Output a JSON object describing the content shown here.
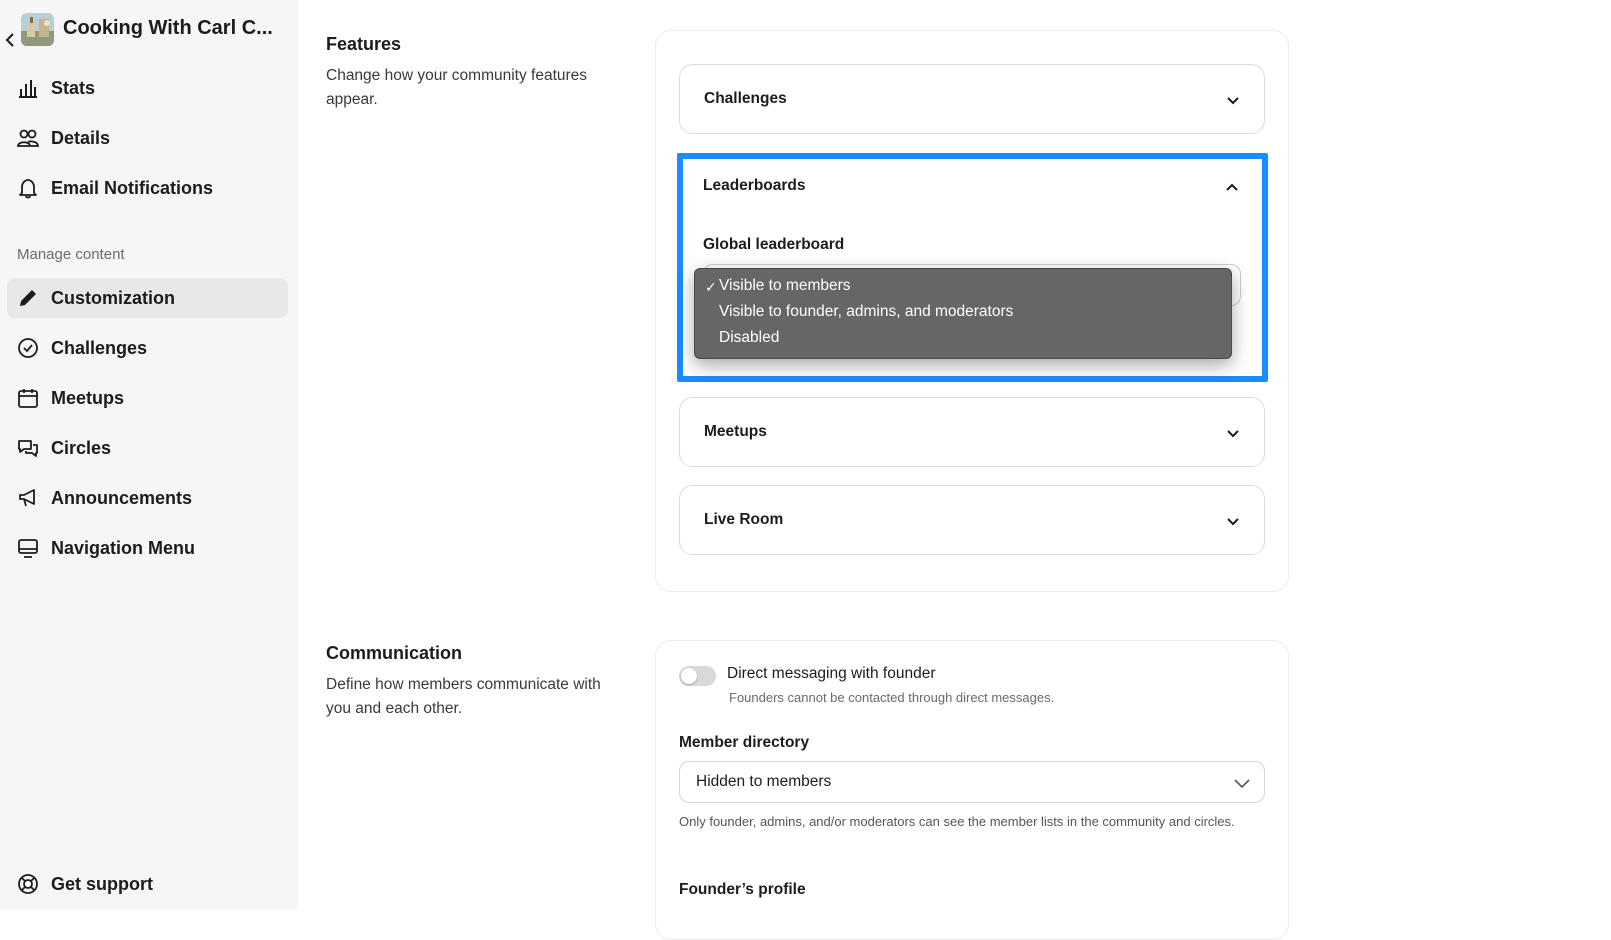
{
  "sidebar": {
    "community_name": "Cooking With Carl C...",
    "items": [
      {
        "label": "Stats",
        "icon": "bar-chart-icon"
      },
      {
        "label": "Details",
        "icon": "users-icon"
      },
      {
        "label": "Email Notifications",
        "icon": "bell-icon"
      }
    ],
    "section_label": "Manage content",
    "content_items": [
      {
        "label": "Customization",
        "icon": "pencil-icon",
        "active": true
      },
      {
        "label": "Challenges",
        "icon": "check-circle-icon"
      },
      {
        "label": "Meetups",
        "icon": "calendar-icon"
      },
      {
        "label": "Circles",
        "icon": "chat-bubbles-icon"
      },
      {
        "label": "Announcements",
        "icon": "megaphone-icon"
      },
      {
        "label": "Navigation Menu",
        "icon": "monitor-icon"
      }
    ],
    "support_label": "Get support"
  },
  "features": {
    "title": "Features",
    "description": "Change how your community features appear.",
    "accordions": {
      "challenges": "Challenges",
      "leaderboards": "Leaderboards",
      "meetups": "Meetups",
      "live_room": "Live Room"
    },
    "global_leaderboard_label": "Global leaderboard",
    "dropdown_options": [
      "Visible to members",
      "Visible to founder, admins, and moderators",
      "Disabled"
    ],
    "dropdown_check": "✓"
  },
  "communication": {
    "title": "Communication",
    "description": "Define how members communicate with you and each other.",
    "dm_label": "Direct messaging with founder",
    "dm_help": "Founders cannot be contacted through direct messages.",
    "member_directory_label": "Member directory",
    "member_directory_value": "Hidden to members",
    "member_directory_help": "Only founder, admins, and/or moderators can see the member lists in the community and circles.",
    "founders_profile_label": "Founder’s profile"
  },
  "colors": {
    "focus": "#1a8cff",
    "sidebar_bg": "#f6f6f6",
    "active_item": "#e8e8e8",
    "dropdown_bg": "#666666"
  }
}
